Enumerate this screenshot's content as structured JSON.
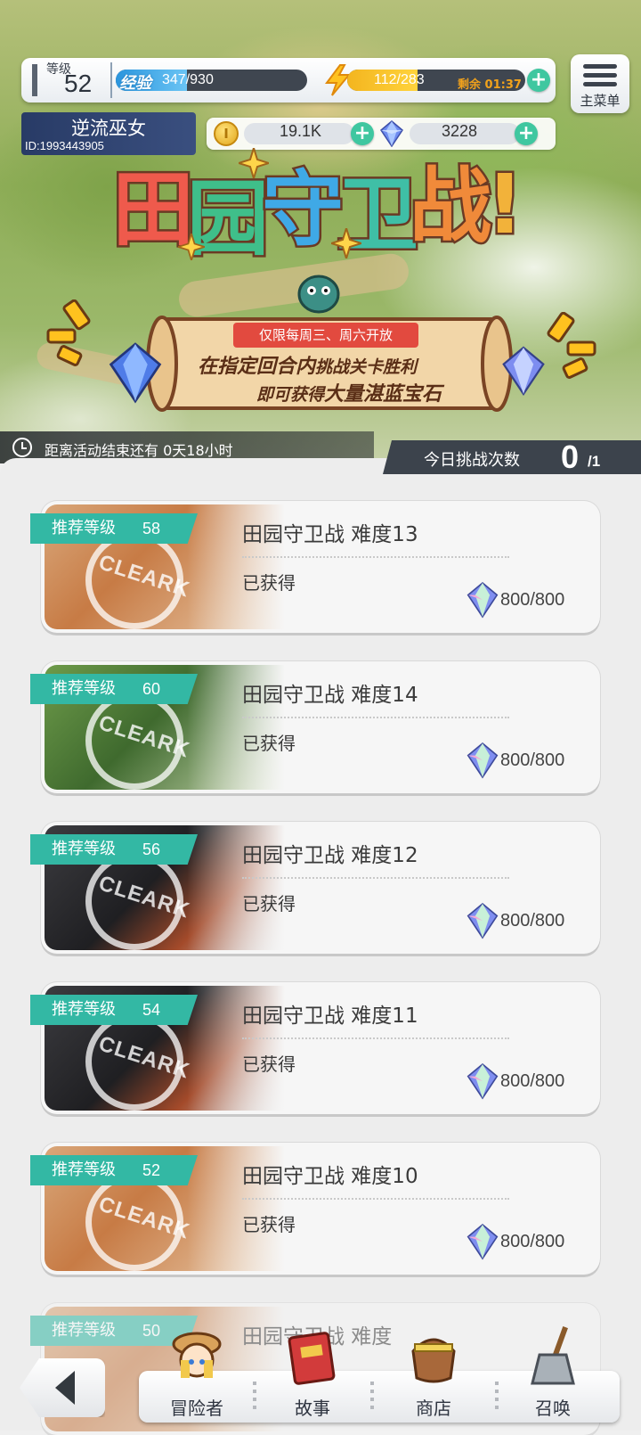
{
  "header": {
    "level_label": "等级",
    "level": "52",
    "exp_tag": "经验",
    "exp_text": "347/930",
    "exp_fraction": 0.373,
    "stamina_text": "112/283",
    "stamina_fraction": 0.396,
    "stamina_timer": "剩余 01:37",
    "menu_label": "主菜单"
  },
  "player": {
    "name": "逆流巫女",
    "id": "ID:1993443905"
  },
  "currency": {
    "coin_symbol": "I",
    "coins": "19.1K",
    "gems": "3228"
  },
  "event": {
    "title_chars": [
      "田",
      "园",
      "守",
      "卫",
      "战",
      "!"
    ],
    "ribbon": "仅限每周三、周六开放",
    "line1_a": "在指定回合内",
    "line1_b": "挑战关卡胜利",
    "line2_a": "即可获得",
    "line2_b": "大量湛蓝宝石",
    "countdown": "距离活动结束还有 0天18小时",
    "challenge_label": "今日挑战次数",
    "challenge_used": "0",
    "challenge_max": "/1"
  },
  "stages": [
    {
      "rec_label": "推荐等级",
      "rec_level": "58",
      "title": "田园守卫战  难度13",
      "status": "已获得",
      "reward": "800/800",
      "stamp": "CLEARK",
      "theme": "orange"
    },
    {
      "rec_label": "推荐等级",
      "rec_level": "60",
      "title": "田园守卫战  难度14",
      "status": "已获得",
      "reward": "800/800",
      "stamp": "CLEARK",
      "theme": "green"
    },
    {
      "rec_label": "推荐等级",
      "rec_level": "56",
      "title": "田园守卫战  难度12",
      "status": "已获得",
      "reward": "800/800",
      "stamp": "CLEARK",
      "theme": "dark"
    },
    {
      "rec_label": "推荐等级",
      "rec_level": "54",
      "title": "田园守卫战  难度11",
      "status": "已获得",
      "reward": "800/800",
      "stamp": "CLEARK",
      "theme": "dark"
    },
    {
      "rec_label": "推荐等级",
      "rec_level": "52",
      "title": "田园守卫战  难度10",
      "status": "已获得",
      "reward": "800/800",
      "stamp": "CLEARK",
      "theme": "orange"
    },
    {
      "rec_label": "推荐等级",
      "rec_level": "50",
      "title": "田园守卫战  难度",
      "status": "",
      "reward": "",
      "stamp": "",
      "theme": "orange"
    }
  ],
  "nav": {
    "items": [
      "冒险者",
      "故事",
      "商店",
      "召唤"
    ]
  },
  "colors": {
    "accent_teal": "#33b8a4",
    "plus_green": "#3fc7a0",
    "exp_blue": "#2b95dd",
    "stamina_yellow": "#f3b51f",
    "ribbon_red": "#e24a3f"
  }
}
